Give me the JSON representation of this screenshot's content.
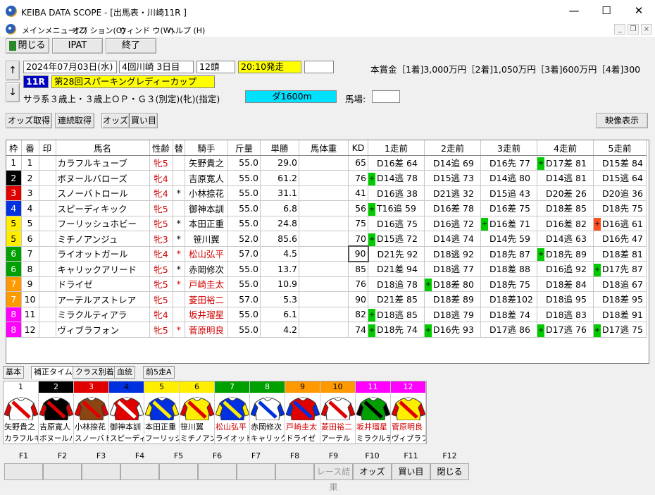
{
  "window": {
    "title": "KEIBA DATA SCOPE - [出馬表・川崎11R ]"
  },
  "menu": {
    "items": [
      "メインメニュー(Z)",
      "オプ ション(O)",
      "ウィンド ウ(W)",
      "ヘルプ (H)"
    ]
  },
  "toolbar": {
    "close": "閉じる",
    "ipat": "IPAT",
    "exit": "終了"
  },
  "race": {
    "date": "2024年07月03日(水)",
    "meet": "4回川崎 3日目",
    "runners": "12頭",
    "start": "20:10発走",
    "number": "11R",
    "name": "第28回スパーキングレディーカップ",
    "conditions": "サラ系３歳上・３歳上ＯＰ・Ｇ３(別定)(牝)(指定)",
    "course": "ダ1600m",
    "baba_label": "馬場:",
    "prize": "本賞金［1着]3,000万円［2着]1,050万円［3着]600万円［4着]300"
  },
  "actions": {
    "odds": "オッズ取得",
    "renren": "連続取得",
    "odds2": "オッズ",
    "kaime": "買い目",
    "video": "映像表示"
  },
  "columns": [
    "枠",
    "番",
    "印",
    "馬名",
    "性齢",
    "替",
    "騎手",
    "斤量",
    "単勝",
    "馬体重",
    "KD",
    "1走前",
    "2走前",
    "3走前",
    "4走前",
    "5走前"
  ],
  "rows": [
    {
      "waku": "1",
      "ban": "1",
      "name": "カラフルキューブ",
      "sex": "牝5",
      "kae": "",
      "jockey": "矢野貴之",
      "jred": false,
      "kin": "55.0",
      "odds": "29.0",
      "kd": "65",
      "r1": "D16差 64",
      "r2": "D14追 69",
      "r3": "D16先 77",
      "r4": "D17差 81",
      "r5": "D15差 84",
      "m": [
        "",
        "",
        "",
        "+",
        ""
      ]
    },
    {
      "waku": "2",
      "ban": "2",
      "name": "ボヌールバローズ",
      "sex": "牝4",
      "kae": "",
      "jockey": "吉原寛人",
      "jred": false,
      "kin": "55.0",
      "odds": "61.2",
      "kd": "76",
      "r1": "D14逃 78",
      "r2": "D15逃 73",
      "r3": "D14逃 80",
      "r4": "D14逃 81",
      "r5": "D15逃 64",
      "m": [
        "+",
        "",
        "",
        "",
        ""
      ]
    },
    {
      "waku": "3",
      "ban": "3",
      "name": "スノーバトロール",
      "sex": "牝4",
      "kae": "*",
      "jockey": "小林捺花",
      "jred": false,
      "kin": "55.0",
      "odds": "31.1",
      "kd": "41",
      "r1": "D16逃 38",
      "r2": "D21逃 32",
      "r3": "D15追 43",
      "r4": "D20差 26",
      "r5": "D20追 36",
      "m": [
        "",
        "",
        "",
        "",
        ""
      ]
    },
    {
      "waku": "4",
      "ban": "4",
      "name": "スピーディキック",
      "sex": "牝5",
      "kae": "",
      "jockey": "御神本訓",
      "jred": false,
      "kin": "55.0",
      "odds": "6.8",
      "kd": "56",
      "r1": "T16追 59",
      "r2": "D16差 78",
      "r3": "D16差 75",
      "r4": "D18差 85",
      "r5": "D18先 75",
      "m": [
        "+",
        "",
        "",
        "",
        ""
      ]
    },
    {
      "waku": "5",
      "ban": "5",
      "name": "フーリッシュホビー",
      "sex": "牝5",
      "kae": "*",
      "jockey": "本田正重",
      "jred": false,
      "kin": "55.0",
      "odds": "24.8",
      "kd": "75",
      "r1": "D16逃 75",
      "r2": "D16逃 72",
      "r3": "D16差 71",
      "r4": "D16差 82",
      "r5": "D16逃 61",
      "m": [
        "",
        "",
        "+",
        "",
        "o"
      ]
    },
    {
      "waku": "5",
      "ban": "6",
      "name": "ミチノアンジュ",
      "sex": "牝3",
      "kae": "*",
      "jockey": "笹川翼",
      "jred": false,
      "kin": "52.0",
      "odds": "85.6",
      "kd": "70",
      "r1": "D15逃 72",
      "r2": "D14逃 74",
      "r3": "D14先 59",
      "r4": "D14逃 63",
      "r5": "D16先 47",
      "m": [
        "+",
        "",
        "",
        "",
        ""
      ]
    },
    {
      "waku": "6",
      "ban": "7",
      "name": "ライオットガール",
      "sex": "牝4",
      "kae": "*",
      "jockey": "松山弘平",
      "jred": true,
      "kin": "57.0",
      "odds": "4.5",
      "kd": "90",
      "r1": "D21先 92",
      "r2": "D18逃 92",
      "r3": "D18先 87",
      "r4": "D18先 89",
      "r5": "D18差 81",
      "m": [
        "",
        "",
        "",
        "+",
        ""
      ]
    },
    {
      "waku": "6",
      "ban": "8",
      "name": "キャリックアリード",
      "sex": "牝5",
      "kae": "*",
      "jockey": "赤岡修次",
      "jred": false,
      "kin": "55.0",
      "odds": "13.7",
      "kd": "85",
      "r1": "D21差 94",
      "r2": "D18逃 77",
      "r3": "D18差 88",
      "r4": "D16追 92",
      "r5": "D17先 87",
      "m": [
        "",
        "",
        "",
        "",
        "+"
      ]
    },
    {
      "waku": "7",
      "ban": "9",
      "name": "ドライゼ",
      "sex": "牝5",
      "kae": "*",
      "jockey": "戸崎圭太",
      "jred": true,
      "kin": "55.0",
      "odds": "10.9",
      "kd": "76",
      "r1": "D18追 78",
      "r2": "D18差 80",
      "r3": "D18先 75",
      "r4": "D18差 84",
      "r5": "D18追 67",
      "m": [
        "",
        "+",
        "",
        "",
        ""
      ]
    },
    {
      "waku": "7",
      "ban": "10",
      "name": "アーテルアストレア",
      "sex": "牝5",
      "kae": "",
      "jockey": "菱田裕二",
      "jred": true,
      "kin": "57.0",
      "odds": "5.3",
      "kd": "90",
      "r1": "D21差 85",
      "r2": "D18差 89",
      "r3": "D18差102",
      "r4": "D18追 95",
      "r5": "D18差 95",
      "m": [
        "",
        "",
        "",
        "",
        ""
      ]
    },
    {
      "waku": "8",
      "ban": "11",
      "name": "ミラクルティアラ",
      "sex": "牝4",
      "kae": "",
      "jockey": "坂井瑠星",
      "jred": true,
      "kin": "55.0",
      "odds": "6.1",
      "kd": "82",
      "r1": "D18逃 85",
      "r2": "D18逃 79",
      "r3": "D18差 74",
      "r4": "D18逃 83",
      "r5": "D18差 91",
      "m": [
        "+",
        "",
        "",
        "",
        ""
      ]
    },
    {
      "waku": "8",
      "ban": "12",
      "name": "ヴィブラフォン",
      "sex": "牝5",
      "kae": "*",
      "jockey": "菅原明良",
      "jred": true,
      "kin": "55.0",
      "odds": "4.2",
      "kd": "74",
      "r1": "D18先 74",
      "r2": "D16先 93",
      "r3": "D17逃 86",
      "r4": "D17逃 76",
      "r5": "D17逃 75",
      "m": [
        "+",
        "+",
        "",
        "+",
        "+"
      ]
    }
  ],
  "tabs": [
    "基本",
    "補正タイム",
    "クラス別着",
    "血統",
    "前5走A"
  ],
  "silks": [
    {
      "n": "1",
      "jockey": "矢野貴之",
      "horse": "カラフルキュ"
    },
    {
      "n": "2",
      "jockey": "吉原寛人",
      "horse": "ボヌールバ"
    },
    {
      "n": "3",
      "jockey": "小林捺花",
      "horse": "スノーバト"
    },
    {
      "n": "4",
      "jockey": "御神本訓",
      "horse": "スピーディ"
    },
    {
      "n": "5",
      "jockey": "本田正重",
      "horse": "フーリッシ"
    },
    {
      "n": "6",
      "jockey": "笹川翼",
      "horse": "ミチノアン"
    },
    {
      "n": "7",
      "jockey": "松山弘平",
      "horse": "ライオット"
    },
    {
      "n": "8",
      "jockey": "赤岡修次",
      "horse": "キャリック"
    },
    {
      "n": "9",
      "jockey": "戸崎圭太",
      "horse": "ドライゼ"
    },
    {
      "n": "10",
      "jockey": "菱田裕二",
      "horse": "アーテル"
    },
    {
      "n": "11",
      "jockey": "坂井瑠星",
      "horse": "ミラクルテ"
    },
    {
      "n": "12",
      "jockey": "菅原明良",
      "horse": "ヴィブラフ"
    }
  ],
  "fkeys": {
    "labels": [
      "F1",
      "F2",
      "F3",
      "F4",
      "F5",
      "F6",
      "F7",
      "F8",
      "F9",
      "F10",
      "F11",
      "F12"
    ],
    "buttons": [
      "",
      "",
      "",
      "",
      "",
      "",
      "",
      "",
      "レース結果",
      "オッズ",
      "買い目",
      "閉じる"
    ]
  },
  "colors": {
    "waku": [
      "#ffffff",
      "#000000",
      "#e00000",
      "#0030e0",
      "#ffee00",
      "#ffee00",
      "#00a000",
      "#00a000",
      "#ff9900",
      "#ff9900",
      "#ff00ff",
      "#ff00ff"
    ],
    "silk_hdr": [
      "#ffffff",
      "#000000",
      "#e00000",
      "#0030e0",
      "#ffee00",
      "#ffee00",
      "#00a000",
      "#00a000",
      "#ff9900",
      "#ff9900",
      "#ff00ff",
      "#ff00ff"
    ]
  }
}
